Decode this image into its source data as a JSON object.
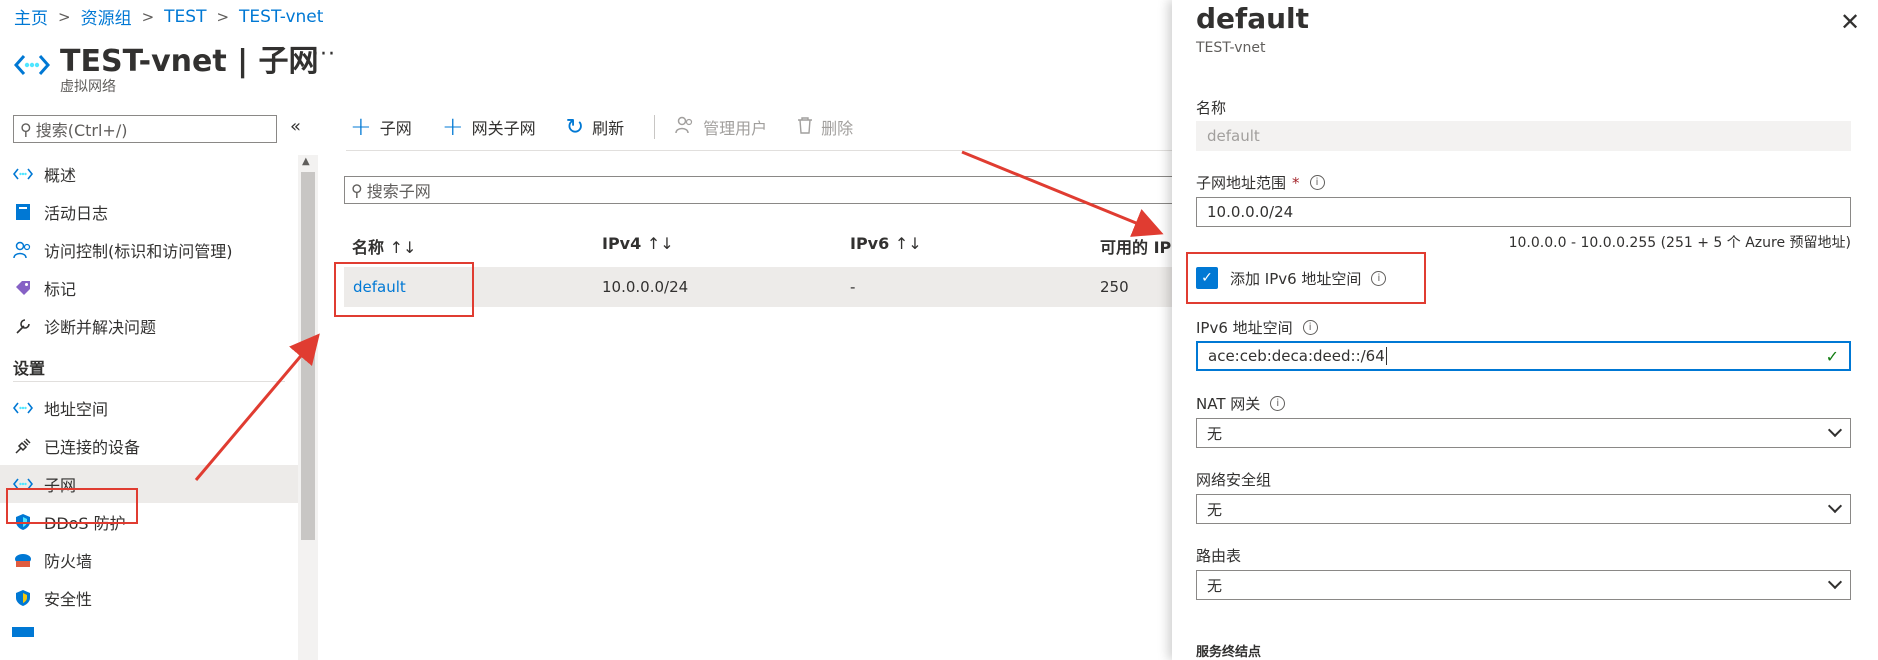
{
  "breadcrumb": [
    "主页",
    "资源组",
    "TEST",
    "TEST-vnet"
  ],
  "header": {
    "title": "TEST-vnet | 子网",
    "subtitle": "虚拟网络",
    "more": "···"
  },
  "left_search": {
    "placeholder": "搜索(Ctrl+/)"
  },
  "nav": {
    "items_top": [
      {
        "label": "概述",
        "icon": "vnet-icon"
      },
      {
        "label": "活动日志",
        "icon": "log-icon"
      },
      {
        "label": "访问控制(标识和访问管理)",
        "icon": "people-icon"
      },
      {
        "label": "标记",
        "icon": "tag-icon"
      },
      {
        "label": "诊断并解决问题",
        "icon": "wrench-icon"
      }
    ],
    "section": "设置",
    "items_settings": [
      {
        "label": "地址空间",
        "icon": "vnet-icon"
      },
      {
        "label": "已连接的设备",
        "icon": "plug-icon"
      },
      {
        "label": "子网",
        "icon": "vnet-icon"
      },
      {
        "label": "DDoS 防护",
        "icon": "shield-icon"
      },
      {
        "label": "防火墙",
        "icon": "firewall-icon"
      },
      {
        "label": "安全性",
        "icon": "shield-icon"
      }
    ]
  },
  "toolbar": {
    "add_subnet": "子网",
    "add_gateway_subnet": "网关子网",
    "refresh": "刷新",
    "manage_users": "管理用户",
    "delete": "删除"
  },
  "subnet_search": {
    "placeholder": "搜索子网"
  },
  "table": {
    "columns": [
      "名称",
      "IPv4",
      "IPv6",
      "可用的 IP"
    ],
    "rows": [
      {
        "name": "default",
        "ipv4": "10.0.0.0/24",
        "ipv6": "-",
        "available": "250"
      }
    ]
  },
  "panel": {
    "title": "default",
    "subtitle": "TEST-vnet",
    "name_label": "名称",
    "name_value": "default",
    "range_label": "子网地址范围",
    "range_value": "10.0.0.0/24",
    "range_hint": "10.0.0.0 - 10.0.0.255 (251 + 5 个 Azure 预留地址)",
    "ipv6_checkbox": "添加 IPv6 地址空间",
    "ipv6_label": "IPv6 地址空间",
    "ipv6_value": "ace:ceb:deca:deed::/64",
    "nat_label": "NAT 网关",
    "nat_value": "无",
    "nsg_label": "网络安全组",
    "nsg_value": "无",
    "route_label": "路由表",
    "route_value": "无",
    "service_endpoints": "服务终结点"
  },
  "colors": {
    "accent": "#0078d4",
    "annotation": "#e03c31",
    "selected": "#edebe9"
  }
}
